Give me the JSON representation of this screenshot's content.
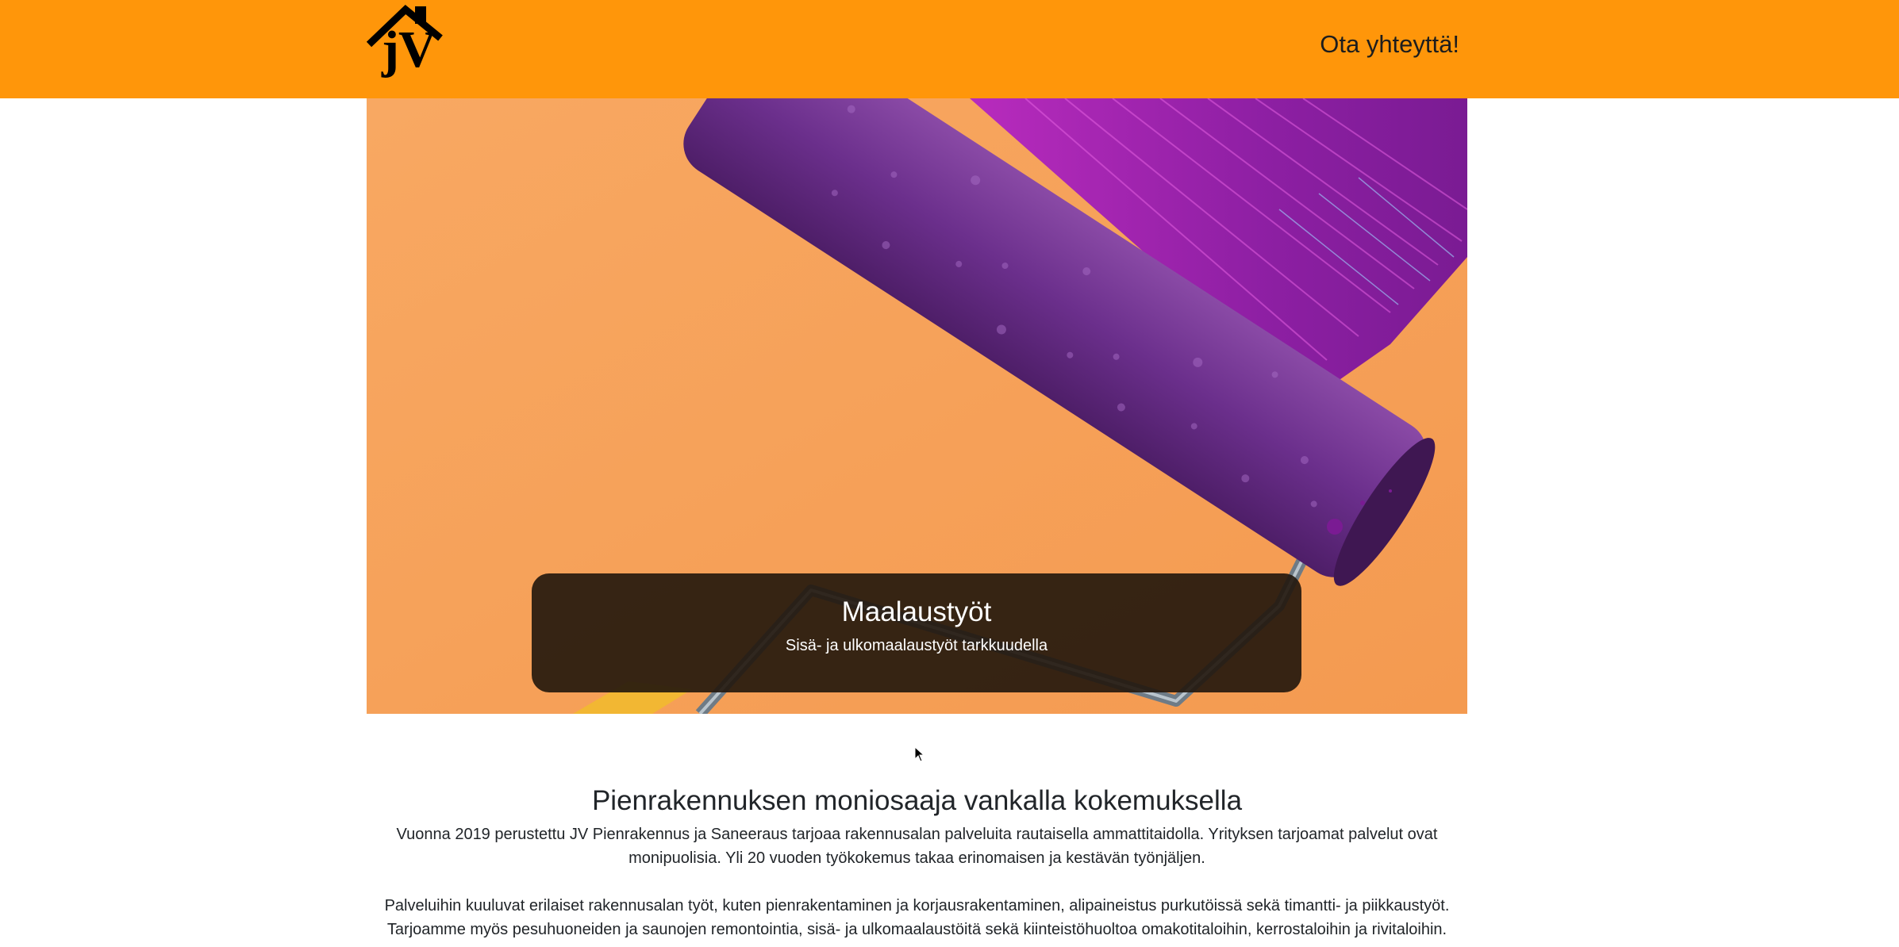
{
  "header": {
    "logo_alt": "JV",
    "logo_text": "jV",
    "contact_link": "Ota yhteyttä!"
  },
  "hero": {
    "image_name": "paint-roller-image",
    "caption_title": "Maalaustyöt",
    "caption_subtitle": "Sisä- ja ulkomaalaustyöt tarkkuudella"
  },
  "main": {
    "heading": "Pienrakennuksen moniosaaja vankalla kokemuksella",
    "paragraph1_line1": "Vuonna 2019 perustettu JV Pienrakennus ja Saneeraus tarjoaa rakennusalan palveluita rautaisella ammattitaidolla. Yrityksen tarjoamat palvelut ovat",
    "paragraph1_line2": "monipuolisia. Yli 20 vuoden työkokemus takaa erinomaisen ja kestävän työnjäljen.",
    "paragraph2_line1": "Palveluihin kuuluvat erilaiset rakennusalan työt, kuten pienrakentaminen ja korjausrakentaminen, alipaineistus purkutöissä sekä timantti- ja piikkaustyöt.",
    "paragraph2_line2": "Tarjoamme myös pesuhuoneiden ja saunojen remontointia, sisä- ja ulkomaalaustöitä sekä kiinteistöhuoltoa omakotitaloihin, kerrostaloihin ja rivitaloihin."
  },
  "colors": {
    "header_bg": "#ff960a",
    "hero_bg": "#f7a55c",
    "roller_purple": "#6a2f8a",
    "paint_magenta": "#a21fb0"
  }
}
